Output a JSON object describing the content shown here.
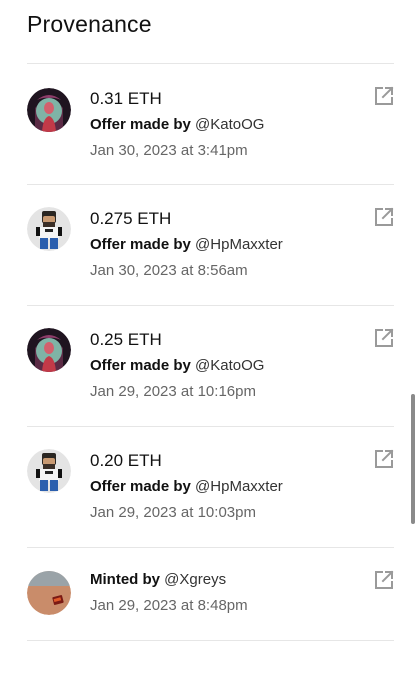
{
  "title": "Provenance",
  "colors": {
    "text": "#111111",
    "muted": "#666666",
    "divider": "#e6e6e6",
    "icon": "#9a9a9a"
  },
  "events": [
    {
      "price": "0.31 ETH",
      "action": "Offer made by",
      "user": "@KatoOG",
      "date": "Jan 30, 2023 at 3:41pm",
      "avatar": "kato-avatar",
      "link_icon": "external-link-icon"
    },
    {
      "price": "0.275 ETH",
      "action": "Offer made by",
      "user": "@HpMaxxter",
      "date": "Jan 30, 2023 at 8:56am",
      "avatar": "hpmaxxter-avatar",
      "link_icon": "external-link-icon"
    },
    {
      "price": "0.25 ETH",
      "action": "Offer made by",
      "user": "@KatoOG",
      "date": "Jan 29, 2023 at 10:16pm",
      "avatar": "kato-avatar",
      "link_icon": "external-link-icon"
    },
    {
      "price": "0.20 ETH",
      "action": "Offer made by",
      "user": "@HpMaxxter",
      "date": "Jan 29, 2023 at 10:03pm",
      "avatar": "hpmaxxter-avatar",
      "link_icon": "external-link-icon"
    },
    {
      "price": "",
      "action": "Minted by",
      "user": "@Xgreys",
      "date": "Jan 29, 2023 at 8:48pm",
      "avatar": "xgreys-avatar",
      "link_icon": "external-link-icon"
    }
  ]
}
